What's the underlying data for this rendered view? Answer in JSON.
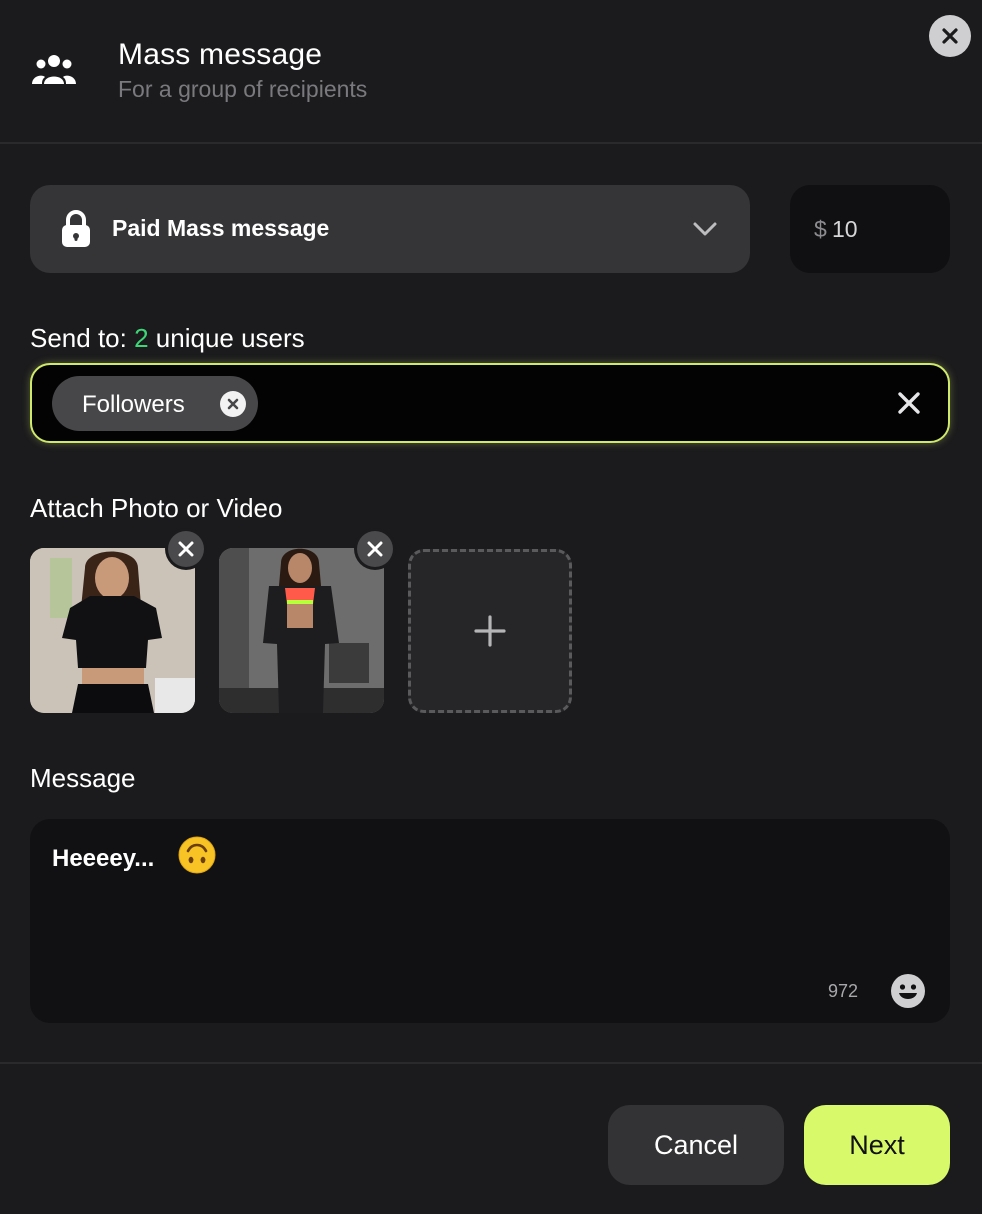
{
  "header": {
    "title": "Mass message",
    "subtitle": "For a group of recipients",
    "group_icon": "group-icon",
    "close_icon": "close-icon"
  },
  "message_type": {
    "selected_label": "Paid Mass message",
    "icon": "lock-icon",
    "dropdown_icon": "chevron-down-icon"
  },
  "price": {
    "currency": "$",
    "value": "10"
  },
  "send_to": {
    "prefix": "Send to:",
    "count": "2",
    "suffix": "unique users",
    "chips": [
      {
        "label": "Followers"
      }
    ],
    "clear_icon": "close-icon"
  },
  "attachments": {
    "label": "Attach Photo or Video",
    "items": [
      {
        "remove_icon": "close-icon"
      },
      {
        "remove_icon": "close-icon"
      }
    ],
    "add_icon": "plus-icon"
  },
  "message": {
    "label": "Message",
    "text": "Heeeey...",
    "inline_emoji": "upside-down-face-emoji",
    "char_count": "972",
    "emoji_button_icon": "smiley-icon"
  },
  "footer": {
    "cancel_label": "Cancel",
    "next_label": "Next"
  },
  "colors": {
    "accent": "#d8fa6a",
    "count_green": "#3dd677",
    "background": "#1b1b1d"
  }
}
